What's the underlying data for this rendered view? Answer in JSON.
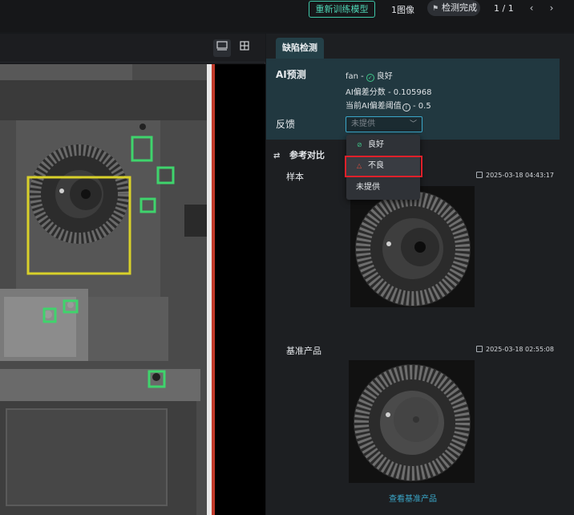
{
  "header": {
    "retrain_button": "重新训练模型",
    "image_count": "1图像",
    "status": "检测完成",
    "pager": "1 / 1",
    "prev_icon": "chevron-left-icon",
    "next_icon": "chevron-right-icon"
  },
  "viewer": {
    "single_view_icon": "single-view-icon",
    "grid_view_icon": "grid-view-icon"
  },
  "panel": {
    "tab": "缺陷检测",
    "ai_prediction": {
      "title": "AI预测",
      "part": "fan -",
      "result": "良好",
      "score_text": "AI偏差分数 - 0.105968",
      "threshold_label": "当前AI偏差阈值",
      "threshold_value": "- 0.5"
    },
    "feedback": {
      "label": "反馈",
      "placeholder": "未提供",
      "options": [
        "良好",
        "不良",
        "未提供"
      ],
      "highlighted_option": "不良"
    },
    "compare": {
      "title": "参考对比",
      "sample_label": "样本",
      "sample_time": "2025-03-18 04:43:17",
      "base_label": "基准产品",
      "base_time": "2025-03-18 02:55:08",
      "view_base_link": "查看基准产品"
    }
  },
  "colors": {
    "accent": "#3fc7a8",
    "link": "#3aa7c9",
    "ok": "#3fc78a",
    "bad": "#e8503f",
    "highlight": "#e0202a",
    "box_yellow": "#d8d02a",
    "box_green": "#3fd46c"
  }
}
